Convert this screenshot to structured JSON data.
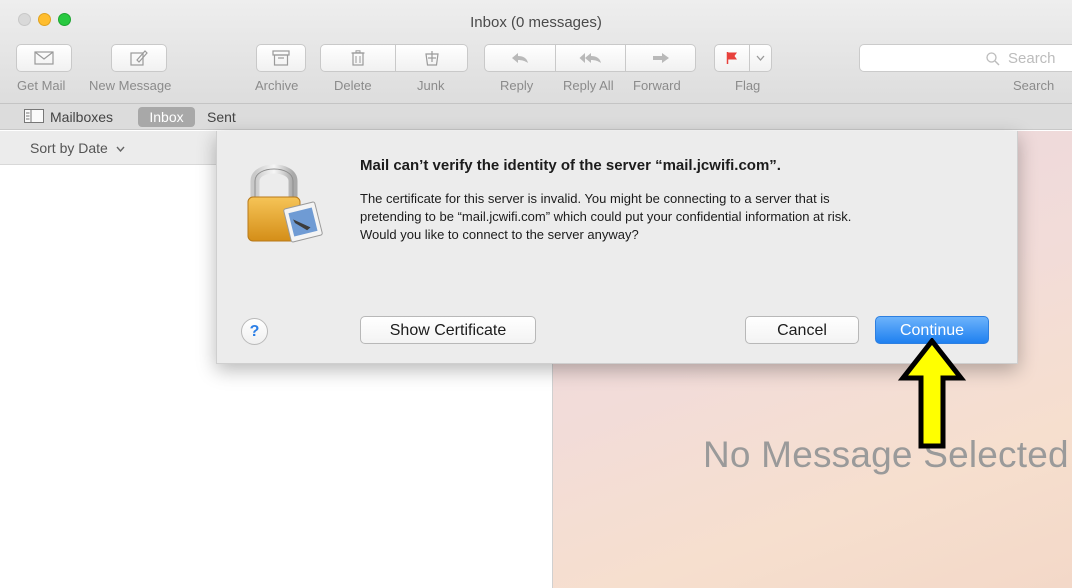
{
  "window": {
    "title": "Inbox (0 messages)"
  },
  "toolbar": {
    "get_mail": "Get Mail",
    "new_message": "New Message",
    "archive": "Archive",
    "delete": "Delete",
    "junk": "Junk",
    "reply": "Reply",
    "reply_all": "Reply All",
    "forward": "Forward",
    "flag": "Flag",
    "search_placeholder": "Search",
    "search_label": "Search"
  },
  "tabs": {
    "mailboxes": "Mailboxes",
    "inbox": "Inbox",
    "sent": "Sent"
  },
  "list": {
    "sort_label": "Sort by Date"
  },
  "viewer": {
    "empty_text": "No Message Selected"
  },
  "alert": {
    "title": "Mail can’t verify the identity of the server “mail.jcwifi.com”.",
    "body_line1": "The certificate for this server is invalid. You might be connecting to a server that is",
    "body_line2": "pretending to be “mail.jcwifi.com” which could put your confidential information at risk.",
    "body_line3": "Would you like to connect to the server anyway?",
    "help": "?",
    "show_certificate": "Show Certificate",
    "cancel": "Cancel",
    "continue": "Continue"
  },
  "colors": {
    "accent": "#1f80f0",
    "arrow_fill": "#ffff00",
    "flag_red": "#e8413c"
  }
}
